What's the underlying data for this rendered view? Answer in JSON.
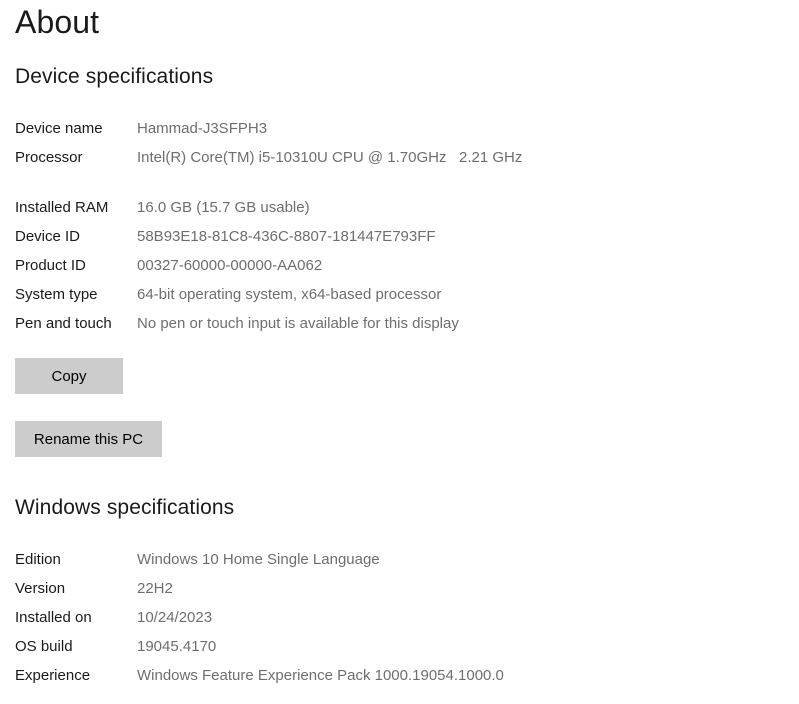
{
  "page": {
    "title": "About"
  },
  "device_specifications": {
    "heading": "Device specifications",
    "rows": [
      {
        "label": "Device name",
        "value": "Hammad-J3SFPH3"
      },
      {
        "label": "Processor",
        "value": "Intel(R) Core(TM) i5-10310U CPU @ 1.70GHz   2.21 GHz"
      },
      {
        "label": "Installed RAM",
        "value": "16.0 GB (15.7 GB usable)"
      },
      {
        "label": "Device ID",
        "value": "58B93E18-81C8-436C-8807-181447E793FF"
      },
      {
        "label": "Product ID",
        "value": "00327-60000-00000-AA062"
      },
      {
        "label": "System type",
        "value": "64-bit operating system, x64-based processor"
      },
      {
        "label": "Pen and touch",
        "value": "No pen or touch input is available for this display"
      }
    ],
    "copy_button": "Copy",
    "rename_button": "Rename this PC"
  },
  "windows_specifications": {
    "heading": "Windows specifications",
    "rows": [
      {
        "label": "Edition",
        "value": "Windows 10 Home Single Language"
      },
      {
        "label": "Version",
        "value": "22H2"
      },
      {
        "label": "Installed on",
        "value": "10/24/2023"
      },
      {
        "label": "OS build",
        "value": "19045.4170"
      },
      {
        "label": "Experience",
        "value": "Windows Feature Experience Pack 1000.19054.1000.0"
      }
    ]
  },
  "colors": {
    "background": "#ffffff",
    "label_text": "#1a1a1a",
    "value_text": "#6e6e6e",
    "button_face": "#cccccc"
  }
}
